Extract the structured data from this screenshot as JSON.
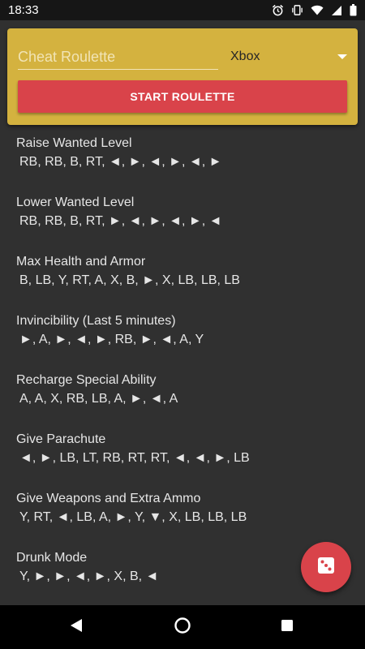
{
  "status_bar": {
    "time": "18:33",
    "icons": [
      "alarm-icon",
      "vibrate-icon",
      "wifi-icon",
      "signal-icon",
      "battery-icon"
    ]
  },
  "header": {
    "title_placeholder": "Cheat Roulette",
    "platform": "Xbox",
    "start_label": "START ROULETTE",
    "colors": {
      "card": "#d4b23f",
      "button": "#d9434a"
    }
  },
  "cheats": [
    {
      "name": "Raise Wanted Level",
      "code": "RB, RB, B, RT, ◄, ►, ◄, ►, ◄, ►"
    },
    {
      "name": "Lower Wanted Level",
      "code": "RB, RB, B, RT, ►, ◄, ►, ◄, ►, ◄"
    },
    {
      "name": "Max Health and Armor",
      "code": "B, LB, Y, RT, A, X, B, ►, X, LB, LB, LB"
    },
    {
      "name": "Invincibility (Last 5 minutes)",
      "code": "►, A, ►, ◄, ►, RB, ►, ◄, A, Y"
    },
    {
      "name": "Recharge Special Ability",
      "code": "A, A, X, RB, LB, A, ►, ◄, A"
    },
    {
      "name": "Give Parachute",
      "code": "◄, ►, LB, LT, RB, RT, RT, ◄, ◄, ►, LB"
    },
    {
      "name": "Give Weapons and Extra Ammo",
      "code": "Y, RT, ◄, LB, A, ►, Y, ▼, X, LB, LB, LB"
    },
    {
      "name": "Drunk Mode",
      "code": "Y, ►, ►, ◄, ►, X, B, ◄"
    }
  ],
  "fab": {
    "icon": "dice-icon"
  },
  "nav_bar": {
    "icons": [
      "back-icon",
      "home-icon",
      "recents-icon"
    ]
  }
}
